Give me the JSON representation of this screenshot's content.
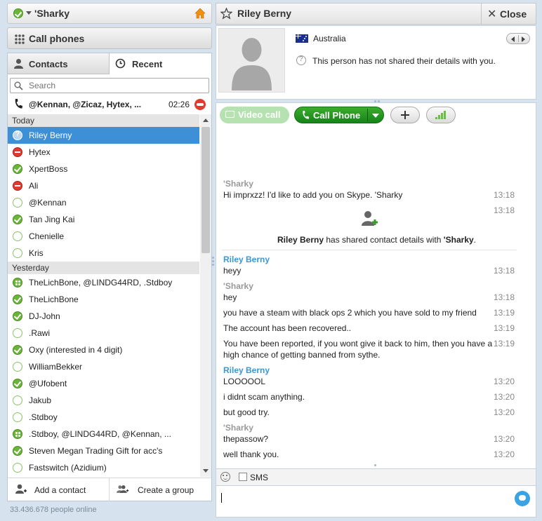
{
  "user": {
    "name": "'Sharky",
    "status_icon": "online-status-icon"
  },
  "call_phones": {
    "label": "Call phones"
  },
  "tabs": {
    "contacts": "Contacts",
    "recent": "Recent"
  },
  "search": {
    "placeholder": "Search",
    "value": ""
  },
  "active_call": {
    "names": "@Kennan, @Zicaz, Hytex, ...",
    "duration": "02:26"
  },
  "sections": [
    {
      "label": "Today",
      "items": [
        {
          "name": "Riley Berny",
          "status": "question",
          "selected": true
        },
        {
          "name": "Hytex",
          "status": "dnd"
        },
        {
          "name": "XpertBoss",
          "status": "online"
        },
        {
          "name": "Ali",
          "status": "dnd"
        },
        {
          "name": "@Kennan",
          "status": "offline"
        },
        {
          "name": "Tan Jing Kai",
          "status": "online"
        },
        {
          "name": "Chenielle",
          "status": "offline"
        },
        {
          "name": "Kris",
          "status": "offline"
        }
      ]
    },
    {
      "label": "Yesterday",
      "items": [
        {
          "name": "TheLichBone, @LINDG44RD, .Stdboy",
          "status": "group"
        },
        {
          "name": "TheLichBone",
          "status": "online"
        },
        {
          "name": "DJ-John",
          "status": "online"
        },
        {
          "name": ".Rawi",
          "status": "offline"
        },
        {
          "name": "Oxy (interested in 4 digit)",
          "status": "online"
        },
        {
          "name": "WilliamBekker",
          "status": "offline"
        },
        {
          "name": "@Ufobent",
          "status": "online"
        },
        {
          "name": "Jakub",
          "status": "offline"
        },
        {
          "name": ".Stdboy",
          "status": "offline"
        },
        {
          "name": ".Stdboy, @LINDG44RD, @Kennan, ...",
          "status": "group"
        },
        {
          "name": "Steven Megan Trading Gift for acc's",
          "status": "online"
        },
        {
          "name": "Fastswitch (Azidium)",
          "status": "offline"
        }
      ]
    }
  ],
  "bottom": {
    "add_contact": "Add a contact",
    "create_group": "Create a group",
    "online_count": "33.436.678 people online"
  },
  "conversation": {
    "contact_name": "Riley Berny",
    "close_label": "Close",
    "country": "Australia",
    "privacy_note": "This person has not shared their details with you.",
    "video_call_label": "Video call",
    "call_phone_label": "Call Phone",
    "shared_contact": {
      "name": "Riley Berny",
      "text": " has shared contact details with ",
      "target": "'Sharky",
      "end": "."
    },
    "messages": [
      {
        "sender": "'Sharky",
        "text": "Hi imprxzz! I'd like to add you on Skype. 'Sharky",
        "time": "13:18"
      },
      {
        "sender": "",
        "text": "",
        "time": "13:18"
      },
      {
        "sender": "Riley Berny",
        "text": "heyy",
        "time": "13:18"
      },
      {
        "sender": "'Sharky",
        "text": "hey",
        "time": "13:18"
      },
      {
        "sender": "",
        "text": "you have a steam with black ops 2 which you have sold to my friend",
        "time": "13:19"
      },
      {
        "sender": "",
        "text": "The account has been recovered..",
        "time": "13:19"
      },
      {
        "sender": "",
        "text": "You have been reported, if you wont give it back to him, then you have a",
        "text2": "high chance of getting banned from sythe.",
        "time": "13:19"
      },
      {
        "sender": "Riley Berny",
        "text": "LOOOOOL",
        "time": "13:20"
      },
      {
        "sender": "",
        "text": "i didnt scam anything.",
        "time": "13:20"
      },
      {
        "sender": "",
        "text": "but good try.",
        "time": "13:20"
      },
      {
        "sender": "'Sharky",
        "text": "thepassow?",
        "time": "13:20"
      },
      {
        "sender": "",
        "text": "well thank you.",
        "time": "13:20"
      }
    ],
    "sms_label": "SMS",
    "message_input_value": ""
  },
  "colors": {
    "accent": "#3d8fd6",
    "online": "#6bb53a",
    "dnd": "#e23b2e",
    "call_green": "#16841a",
    "sender_blue": "#3a96d5"
  }
}
